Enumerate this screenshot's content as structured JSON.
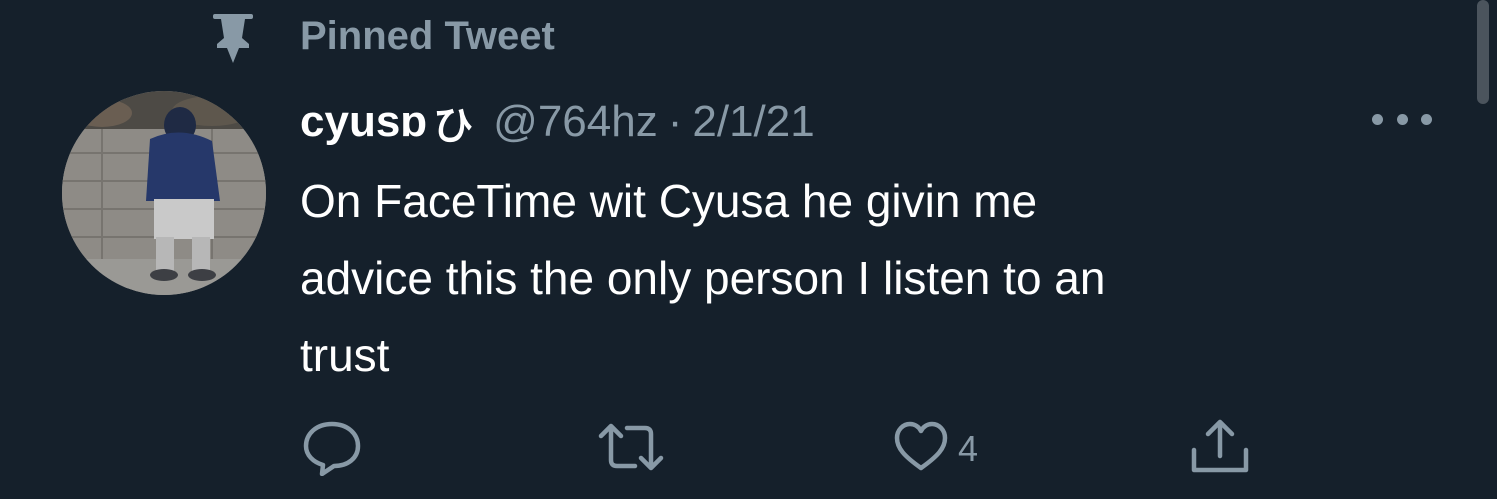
{
  "pinned": {
    "label": "Pinned Tweet",
    "icon": "pin-icon"
  },
  "tweet": {
    "display_name": "cyusɒ",
    "name_glyph": "ひ",
    "handle": "@764hz",
    "separator": "·",
    "date": "2/1/21",
    "text_lines": [
      "On FaceTime wit Cyusa he givin me",
      "advice this the only person I listen to an",
      "trust"
    ],
    "actions": {
      "reply_icon": "reply-icon",
      "retweet_icon": "retweet-icon",
      "like_icon": "heart-icon",
      "like_count": "4",
      "share_icon": "share-icon"
    },
    "more_icon": "more-dots-icon"
  },
  "colors": {
    "background": "#15202b",
    "primary_text": "#ffffff",
    "secondary_text": "#8899a6"
  }
}
